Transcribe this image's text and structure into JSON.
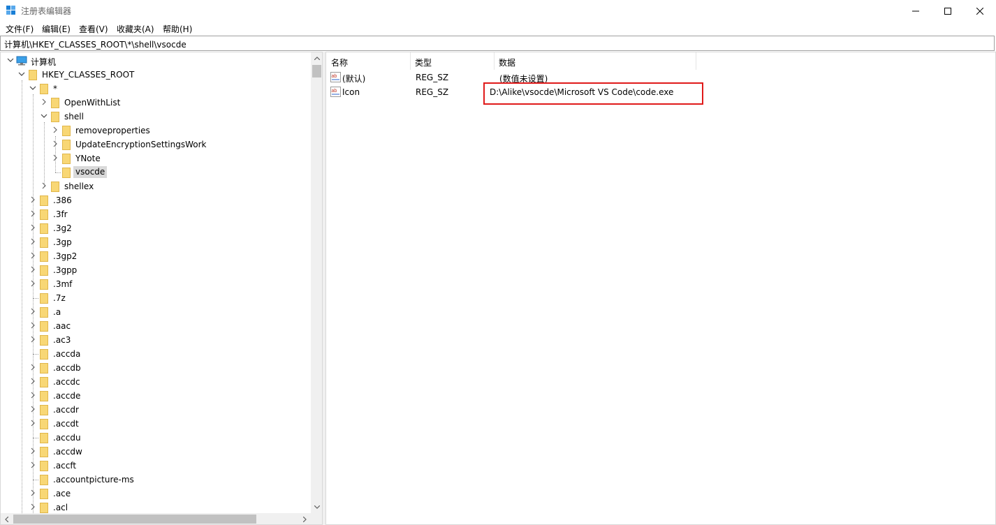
{
  "window": {
    "title": "注册表编辑器"
  },
  "menu": [
    "文件(F)",
    "编辑(E)",
    "查看(V)",
    "收藏夹(A)",
    "帮助(H)"
  ],
  "address": "计算机\\HKEY_CLASSES_ROOT\\*\\shell\\vsocde",
  "tree": {
    "root": "计算机",
    "hive": "HKEY_CLASSES_ROOT",
    "star": "*",
    "star_children": {
      "openwithlist": "OpenWithList",
      "shell": "shell",
      "shell_children": [
        "removeproperties",
        "UpdateEncryptionSettingsWork",
        "YNote",
        "vsocde"
      ],
      "shellex": "shellex"
    },
    "extensions": [
      ".386",
      ".3fr",
      ".3g2",
      ".3gp",
      ".3gp2",
      ".3gpp",
      ".3mf",
      ".7z",
      ".a",
      ".aac",
      ".ac3",
      ".accda",
      ".accdb",
      ".accdc",
      ".accde",
      ".accdr",
      ".accdt",
      ".accdu",
      ".accdw",
      ".accft",
      ".accountpicture-ms",
      ".ace",
      ".acl"
    ],
    "selected": "vsocde"
  },
  "list": {
    "columns": [
      "名称",
      "类型",
      "数据"
    ],
    "rows": [
      {
        "name": "(默认)",
        "type": "REG_SZ",
        "data": "(数值未设置)"
      },
      {
        "name": "Icon",
        "type": "REG_SZ",
        "data": "D:\\Alike\\vsocde\\Microsoft VS Code\\code.exe"
      }
    ]
  },
  "colors": {
    "highlight_box": "#e01a1a",
    "folder": "#f8d775",
    "selection": "#d9d9d9"
  }
}
